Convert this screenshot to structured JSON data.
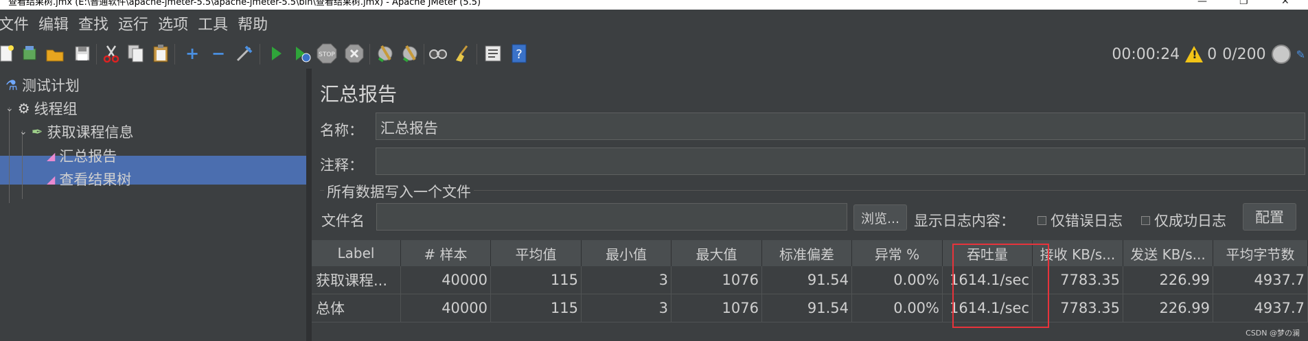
{
  "window": {
    "title": "查看结果树.jmx (E:\\普通软件\\apache-jmeter-5.5\\apache-jmeter-5.5\\bin\\查看结果树.jmx) - Apache JMeter (5.5)"
  },
  "menu": [
    "文件",
    "编辑",
    "查找",
    "运行",
    "选项",
    "工具",
    "帮助"
  ],
  "toolbar": {
    "icons": [
      "new-icon",
      "templates-icon",
      "open-icon",
      "save-icon",
      "cut-icon",
      "copy-icon",
      "paste-icon",
      "expand-icon",
      "collapse-icon",
      "toggle-icon",
      "start-icon",
      "start-no-pause-icon",
      "stop-icon",
      "shutdown-icon",
      "clear-icon",
      "clear-all-icon",
      "search-icon",
      "reset-search-icon",
      "function-helper-icon",
      "help-icon"
    ],
    "timer": "00:00:24",
    "warning_count": "0",
    "threads": "0/200"
  },
  "tree": {
    "items": [
      {
        "label": "测试计划",
        "icon": "test-plan-icon"
      },
      {
        "label": "线程组",
        "icon": "gear-icon"
      },
      {
        "label": "获取课程信息",
        "icon": "sampler-pen-icon"
      },
      {
        "label": "汇总报告",
        "icon": "listener-icon"
      },
      {
        "label": "查看结果树",
        "icon": "listener-icon"
      }
    ],
    "selected_index": 3
  },
  "panel": {
    "title": "汇总报告",
    "name_label": "名称：",
    "name_value": "汇总报告",
    "comment_label": "注释：",
    "comment_value": "",
    "group_title": "所有数据写入一个文件",
    "filename_label": "文件名",
    "filename_value": "",
    "browse_button": "浏览...",
    "log_label": "显示日志内容：",
    "errors_only": "仅错误日志",
    "success_only": "仅成功日志",
    "configure_button": "配置"
  },
  "table": {
    "columns": [
      "Label",
      "# 样本",
      "平均值",
      "最小值",
      "最大值",
      "标准偏差",
      "异常 %",
      "吞吐量",
      "接收 KB/s...",
      "发送 KB/s...",
      "平均字节数"
    ],
    "rows": [
      [
        "获取课程...",
        "40000",
        "115",
        "3",
        "1076",
        "91.54",
        "0.00%",
        "1614.1/sec",
        "7783.35",
        "226.99",
        "4937.7"
      ],
      [
        "总体",
        "40000",
        "115",
        "3",
        "1076",
        "91.54",
        "0.00%",
        "1614.1/sec",
        "7783.35",
        "226.99",
        "4937.7"
      ]
    ]
  },
  "watermark": "CSDN @梦の澜",
  "colors": {
    "background": "#3c3f41",
    "selection": "#4b6eaf",
    "highlight_box": "#e8333b"
  }
}
